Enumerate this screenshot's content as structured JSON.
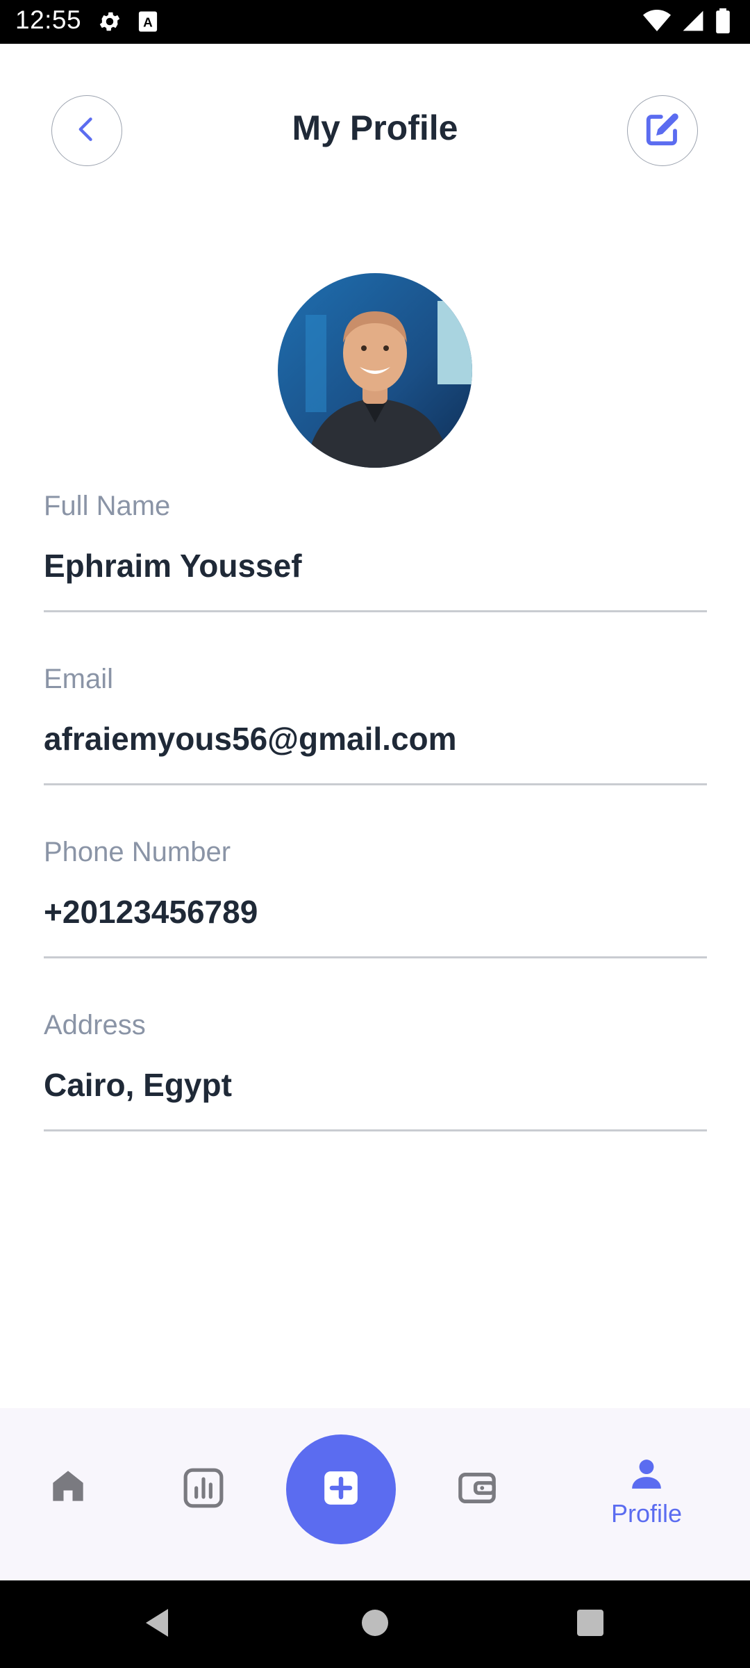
{
  "status_bar": {
    "time": "12:55",
    "left_icons": [
      "settings-icon",
      "keyboard-a-icon"
    ],
    "right_icons": [
      "wifi-icon",
      "signal-icon",
      "battery-icon"
    ]
  },
  "header": {
    "title": "My Profile",
    "back_icon": "chevron-left-icon",
    "edit_icon": "edit-icon"
  },
  "profile": {
    "avatar": "profile-photo",
    "fields": [
      {
        "label": "Full Name",
        "value": "Ephraim Youssef"
      },
      {
        "label": "Email",
        "value": "afraiemyous56@gmail.com"
      },
      {
        "label": "Phone Number",
        "value": "+20123456789"
      },
      {
        "label": "Address",
        "value": "Cairo, Egypt"
      }
    ]
  },
  "bottom_nav": {
    "items": [
      {
        "icon": "home-icon",
        "label": ""
      },
      {
        "icon": "chart-icon",
        "label": ""
      },
      {
        "icon": "plus-icon",
        "label": ""
      },
      {
        "icon": "wallet-icon",
        "label": ""
      },
      {
        "icon": "profile-icon",
        "label": "Profile"
      }
    ],
    "active_index": 4
  },
  "colors": {
    "accent": "#5b6cf0",
    "label": "#8a94a6",
    "text": "#1f2937",
    "nav_bg": "#f8f6fc",
    "nav_inactive": "#7a7a80"
  },
  "system_nav": [
    "back-triangle-icon",
    "home-circle-icon",
    "recents-square-icon"
  ]
}
